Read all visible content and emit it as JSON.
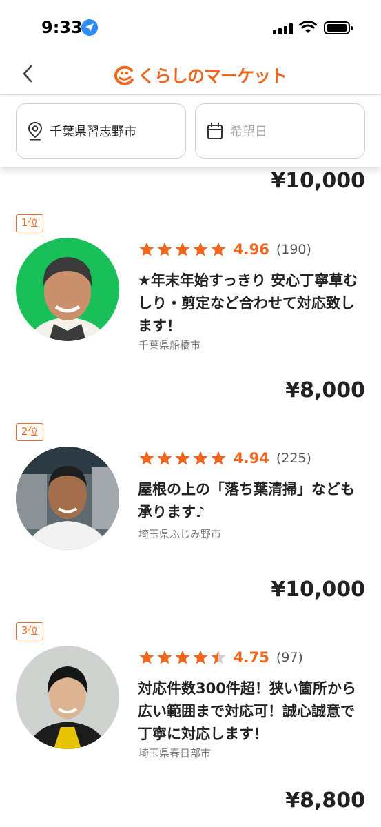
{
  "status_bar": {
    "time": "9:33"
  },
  "header": {
    "logo_text": "くらしのマーケット"
  },
  "filters": {
    "location": "千葉県習志野市",
    "date_placeholder": "希望日"
  },
  "top_price": "¥10,000",
  "listings": [
    {
      "rank": "1位",
      "rating": 4.96,
      "rating_text": "4.96",
      "reviews": "(190)",
      "title": "★年末年始すっきり 安心丁寧草むしり・剪定など合わせて対応致します！",
      "location": "千葉県船橋市",
      "price": "¥8,000"
    },
    {
      "rank": "2位",
      "rating": 4.94,
      "rating_text": "4.94",
      "reviews": "(225)",
      "title": "屋根の上の「落ち葉清掃」なども承ります♪",
      "location": "埼玉県ふじみ野市",
      "price": "¥10,000"
    },
    {
      "rank": "3位",
      "rating": 4.75,
      "rating_text": "4.75",
      "reviews": "(97)",
      "title": "対応件数300件超！狭い箇所から広い範囲まで対応可！誠心誠意で丁寧に対応します！",
      "location": "埼玉県春日部市",
      "price": "¥8,800"
    }
  ],
  "colors": {
    "accent": "#f0661e",
    "star_empty": "#cfcfcf"
  }
}
